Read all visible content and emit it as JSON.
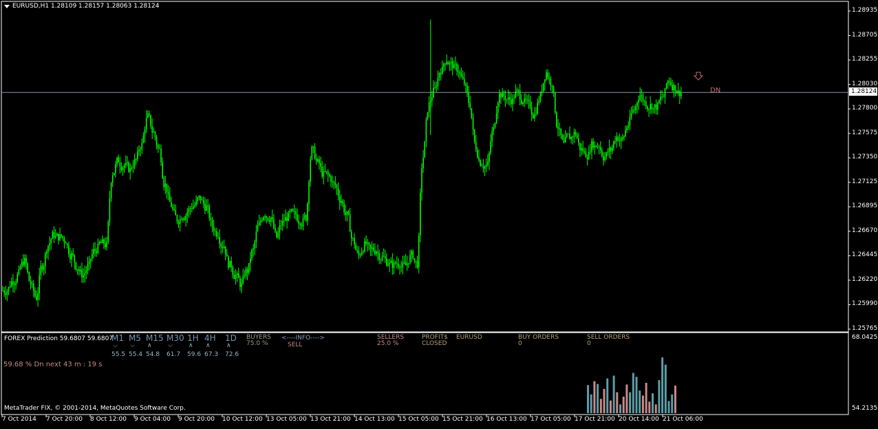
{
  "header": {
    "symbol_line": "EURUSD,H1  1.28109 1.28157 1.28063 1.28124",
    "current_price_label": "1.28124",
    "signal_label": "DN",
    "signal_arrow": "down-arrow-icon"
  },
  "price_axis": {
    "ticks": [
      "1.28935",
      "1.28705",
      "1.28255",
      "1.28030",
      "1.27800",
      "1.27575",
      "1.27350",
      "1.27125",
      "1.26895",
      "1.26670",
      "1.26445",
      "1.26220",
      "1.25990",
      "1.25765"
    ]
  },
  "time_axis": {
    "ticks": [
      "7 Oct 2014",
      "7 Oct 20:00",
      "8 Oct 12:00",
      "9 Oct 04:00",
      "9 Oct 20:00",
      "10 Oct 12:00",
      "13 Oct 05:00",
      "13 Oct 21:00",
      "14 Oct 13:00",
      "15 Oct 05:00",
      "15 Oct 21:00",
      "16 Oct 13:00",
      "17 Oct 05:00",
      "17 Oct 21:00",
      "20 Oct 14:00",
      "21 Oct 06:00"
    ]
  },
  "indicator": {
    "name": "FOREX Prediction 59.6807 59.6807",
    "timeframes": [
      {
        "label": "M1",
        "value": "55.5",
        "arrow": "down"
      },
      {
        "label": "M5",
        "value": "55.4",
        "arrow": "down"
      },
      {
        "label": "M15",
        "value": "54.8",
        "arrow": "up"
      },
      {
        "label": "M30",
        "value": "61.7",
        "arrow": "down"
      },
      {
        "label": "1H",
        "value": "59.6",
        "arrow": "up"
      },
      {
        "label": "4H",
        "value": "67.3",
        "arrow": "up"
      },
      {
        "label": "1D",
        "value": "72.6",
        "arrow": "up"
      }
    ],
    "buyers_label": "BUYERS",
    "buyers_value": "75.0 %",
    "info_label": "<----INFO---->",
    "info_value": "SELL",
    "sellers_label": "SELLERS",
    "sellers_value": "25.0 %",
    "profits_label": "PROFIT$",
    "profits_value": "CLOSED",
    "symbol": "EURUSD",
    "buy_orders_label": "BUY ORDERS",
    "buy_orders_value": "0",
    "sell_orders_label": "SELL ORDERS",
    "sell_orders_value": "0",
    "prediction_text": "59.68 % Dn next 43 m : 19 s",
    "scale_top": "68.0425",
    "scale_bottom": "54.2135",
    "copyright": "MetaTrader FIX, © 2001-2014, MetaQuotes Software Corp."
  },
  "colors": {
    "background": "#000000",
    "candle": "#00ff00",
    "price_line": "#8e96a4",
    "signal": "#c56b6b",
    "histogram_blue": "#5b9ea8",
    "histogram_pink": "#c98a8a",
    "tf_label": "#7a95ad"
  },
  "chart_data": {
    "type": "line",
    "title": "",
    "series": [
      {
        "values": [
          1.2615,
          1.2625,
          1.2632,
          1.2644,
          1.2622,
          1.2608,
          1.264,
          1.266,
          1.2671,
          1.2668,
          1.2665,
          1.265,
          1.2638,
          1.263,
          1.264,
          1.2655,
          1.2662,
          1.266,
          1.2732,
          1.2745,
          1.274,
          1.2735,
          1.2745,
          1.276,
          1.2788,
          1.2772,
          1.2755,
          1.272,
          1.27,
          1.2686,
          1.269,
          1.2695,
          1.27,
          1.2707,
          1.2698,
          1.268,
          1.2672,
          1.266,
          1.264,
          1.263,
          1.262,
          1.2635,
          1.2655,
          1.268,
          1.2692,
          1.2688,
          1.2668,
          1.2682,
          1.2688,
          1.269,
          1.2685,
          1.2688,
          1.2755,
          1.2742,
          1.273,
          1.2728,
          1.272,
          1.2705,
          1.269,
          1.2665,
          1.265,
          1.266,
          1.2655,
          1.2655,
          1.2648,
          1.2643,
          1.264,
          1.2642,
          1.264,
          1.265,
          1.2642,
          1.2748,
          1.28,
          1.2815,
          1.2835,
          1.2845,
          1.284,
          1.2835,
          1.2822,
          1.28,
          1.2758,
          1.2742,
          1.274,
          1.2775,
          1.281,
          1.2808,
          1.2805,
          1.2812,
          1.2805,
          1.28,
          1.279,
          1.2808,
          1.2832,
          1.2822,
          1.2778,
          1.276,
          1.2768,
          1.2772,
          1.2755,
          1.275,
          1.2762,
          1.276,
          1.2748,
          1.2755,
          1.2768,
          1.2765,
          1.278,
          1.2795,
          1.281,
          1.2802,
          1.28,
          1.2798,
          1.2808,
          1.2825,
          1.2818,
          1.2812
        ]
      }
    ],
    "ylim": [
      1.25765,
      1.28935
    ],
    "current_price": 1.28124,
    "indicator_histogram": {
      "bars": [
        {
          "value": 59.3,
          "color": "blue"
        },
        {
          "value": 57.6,
          "color": "blue"
        },
        {
          "value": 60.0,
          "color": "pink"
        },
        {
          "value": 59.5,
          "color": "blue"
        },
        {
          "value": 56.8,
          "color": "pink"
        },
        {
          "value": 58.6,
          "color": "pink"
        },
        {
          "value": 60.5,
          "color": "blue"
        },
        {
          "value": 56.5,
          "color": "pink"
        },
        {
          "value": 61.0,
          "color": "blue"
        },
        {
          "value": 58.0,
          "color": "pink"
        },
        {
          "value": 55.8,
          "color": "blue"
        },
        {
          "value": 57.2,
          "color": "pink"
        },
        {
          "value": 59.4,
          "color": "pink"
        },
        {
          "value": 58.0,
          "color": "blue"
        },
        {
          "value": 61.5,
          "color": "blue"
        },
        {
          "value": 60.8,
          "color": "blue"
        },
        {
          "value": 58.3,
          "color": "blue"
        },
        {
          "value": 57.4,
          "color": "pink"
        },
        {
          "value": 59.7,
          "color": "pink"
        },
        {
          "value": 56.3,
          "color": "pink"
        },
        {
          "value": 57.8,
          "color": "blue"
        },
        {
          "value": 55.8,
          "color": "pink"
        },
        {
          "value": 60.2,
          "color": "blue"
        },
        {
          "value": 64.3,
          "color": "blue"
        },
        {
          "value": 63.0,
          "color": "blue"
        },
        {
          "value": 56.4,
          "color": "blue"
        },
        {
          "value": 57.6,
          "color": "blue"
        },
        {
          "value": 59.2,
          "color": "pink"
        }
      ],
      "ylim": [
        54.2135,
        68.0425
      ]
    }
  }
}
